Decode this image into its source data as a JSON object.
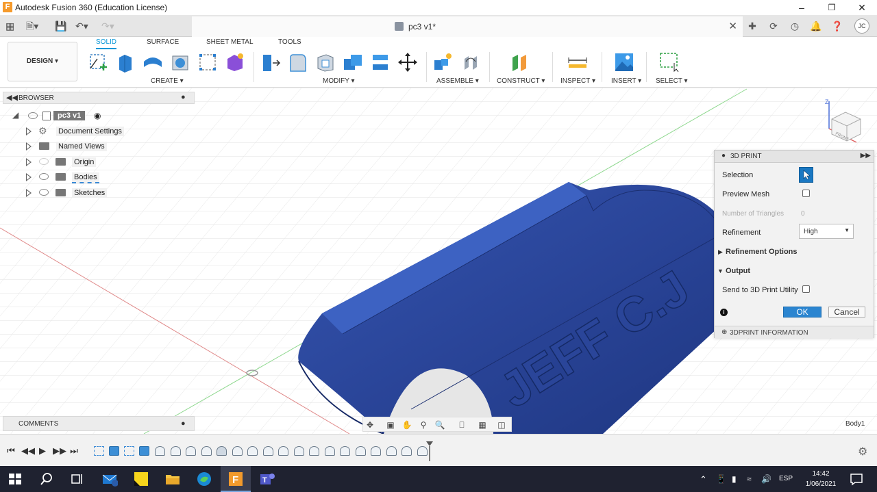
{
  "window": {
    "title": "Autodesk Fusion 360 (Education License)",
    "minimize_icon": "minimize-icon",
    "maximize_icon": "restore-icon",
    "close_icon": "close-icon"
  },
  "document": {
    "tab_title": "pc3 v1*"
  },
  "ribbon": {
    "workspace": "DESIGN",
    "tabs": [
      {
        "label": "SOLID",
        "active": true
      },
      {
        "label": "SURFACE",
        "active": false
      },
      {
        "label": "SHEET METAL",
        "active": false
      },
      {
        "label": "TOOLS",
        "active": false
      }
    ],
    "groups": [
      {
        "label": "CREATE"
      },
      {
        "label": "MODIFY"
      },
      {
        "label": "ASSEMBLE"
      },
      {
        "label": "CONSTRUCT"
      },
      {
        "label": "INSPECT"
      },
      {
        "label": "INSERT"
      },
      {
        "label": "SELECT"
      }
    ]
  },
  "browser": {
    "title": "BROWSER",
    "root": "pc3 v1",
    "items": [
      {
        "label": "Document Settings"
      },
      {
        "label": "Named Views"
      },
      {
        "label": "Origin"
      },
      {
        "label": "Bodies"
      },
      {
        "label": "Sketches"
      }
    ]
  },
  "comments": {
    "title": "COMMENTS"
  },
  "print_dialog": {
    "title": "3D PRINT",
    "selection_label": "Selection",
    "preview_mesh_label": "Preview Mesh",
    "triangles_label": "Number of Triangles",
    "triangles_value": "0",
    "refinement_label": "Refinement",
    "refinement_value": "High",
    "refinement_options_label": "Refinement Options",
    "output_label": "Output",
    "send_label": "Send to 3D Print Utility",
    "ok_label": "OK",
    "cancel_label": "Cancel",
    "info_label": "3DPRINT INFORMATION"
  },
  "viewport": {
    "body_label": "Body1",
    "model_text": "JEFF C.J",
    "viewcube_face": "FRONT",
    "axis_label": "Z"
  },
  "taskbar": {
    "language": "ESP",
    "time": "14:42",
    "date": "1/06/2021"
  },
  "colors": {
    "accent": "#0696d7",
    "model": "#2d4a9c",
    "taskbar": "#1f2230"
  }
}
